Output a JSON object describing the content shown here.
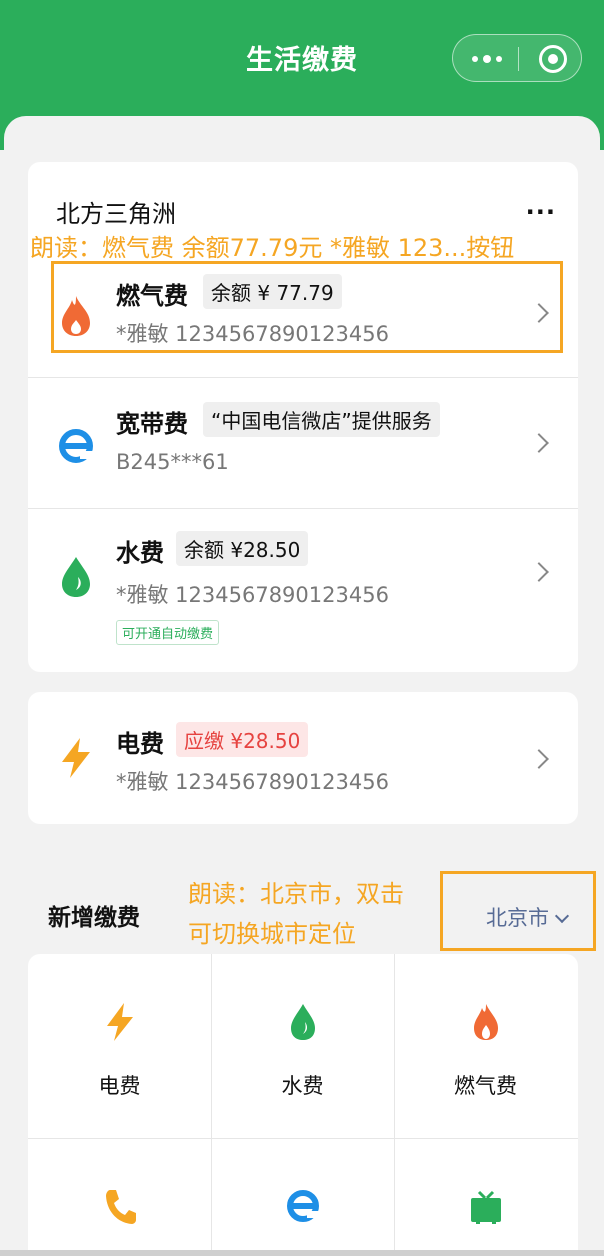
{
  "header": {
    "title": "生活缴费",
    "more_icon": "more-dots-icon",
    "close_icon": "target-icon"
  },
  "account": {
    "name": "北方三角洲",
    "more": "···"
  },
  "bills": [
    {
      "name": "燃气费",
      "tag": "余额 ¥ 77.79",
      "sub": "*雅敏  1234567890123456",
      "icon": "flame-icon",
      "color": "#f06a35"
    },
    {
      "name": "宽带费",
      "tag": "“中国电信微店”提供服务",
      "sub": "B245***61",
      "icon": "ie-icon",
      "color": "#1e8fe6"
    },
    {
      "name": "水费",
      "tag": "余额 ¥28.50",
      "sub": "*雅敏  1234567890123456",
      "extra": "可开通自动缴费",
      "icon": "water-drop-icon",
      "color": "#2bae5b"
    },
    {
      "name": "电费",
      "tag": "应缴 ¥28.50",
      "sub": "*雅敏  1234567890123456",
      "icon": "lightning-icon",
      "color": "#f5a623"
    }
  ],
  "annotations": {
    "gas_readout": "朗读：燃气费 余额77.79元 *雅敏 123...按钮",
    "city_readout_line1": "朗读：北京市，双击",
    "city_readout_line2": "可切换城市定位"
  },
  "new_payment": {
    "title": "新增缴费",
    "city": "北京市",
    "items": [
      {
        "label": "电费",
        "icon": "lightning-icon"
      },
      {
        "label": "水费",
        "icon": "water-drop-icon"
      },
      {
        "label": "燃气费",
        "icon": "flame-icon"
      },
      {
        "label": "",
        "icon": "phone-icon"
      },
      {
        "label": "",
        "icon": "ie-icon"
      },
      {
        "label": "",
        "icon": "tv-icon"
      }
    ]
  },
  "colors": {
    "brand_green": "#2bae5b",
    "annotation": "#f5a623",
    "due_red": "#e64340",
    "link_blue": "#576b95"
  }
}
